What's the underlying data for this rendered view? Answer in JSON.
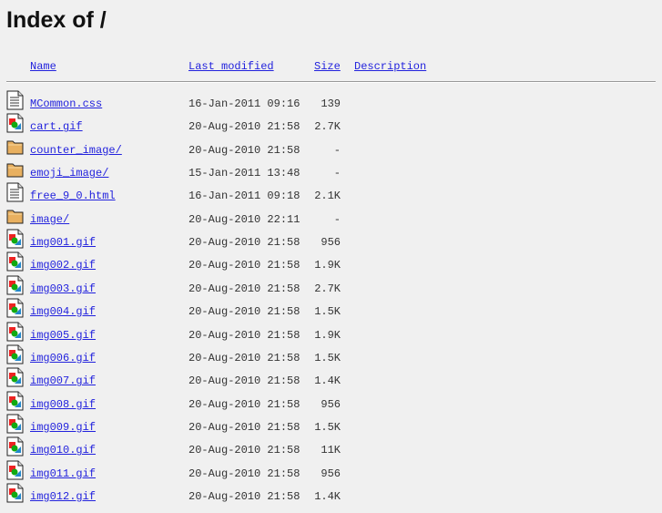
{
  "title": "Index of /",
  "columns": {
    "name": "Name",
    "modified": "Last modified",
    "size": "Size",
    "description": "Description"
  },
  "entries": [
    {
      "icon": "text",
      "name": "MCommon.css",
      "modified": "16-Jan-2011 09:16",
      "size": "139"
    },
    {
      "icon": "image",
      "name": "cart.gif",
      "modified": "20-Aug-2010 21:58",
      "size": "2.7K"
    },
    {
      "icon": "folder",
      "name": "counter_image/",
      "modified": "20-Aug-2010 21:58",
      "size": "-"
    },
    {
      "icon": "folder",
      "name": "emoji_image/",
      "modified": "15-Jan-2011 13:48",
      "size": "-"
    },
    {
      "icon": "text",
      "name": "free_9_0.html",
      "modified": "16-Jan-2011 09:18",
      "size": "2.1K"
    },
    {
      "icon": "folder",
      "name": "image/",
      "modified": "20-Aug-2010 22:11",
      "size": "-"
    },
    {
      "icon": "image",
      "name": "img001.gif",
      "modified": "20-Aug-2010 21:58",
      "size": "956"
    },
    {
      "icon": "image",
      "name": "img002.gif",
      "modified": "20-Aug-2010 21:58",
      "size": "1.9K"
    },
    {
      "icon": "image",
      "name": "img003.gif",
      "modified": "20-Aug-2010 21:58",
      "size": "2.7K"
    },
    {
      "icon": "image",
      "name": "img004.gif",
      "modified": "20-Aug-2010 21:58",
      "size": "1.5K"
    },
    {
      "icon": "image",
      "name": "img005.gif",
      "modified": "20-Aug-2010 21:58",
      "size": "1.9K"
    },
    {
      "icon": "image",
      "name": "img006.gif",
      "modified": "20-Aug-2010 21:58",
      "size": "1.5K"
    },
    {
      "icon": "image",
      "name": "img007.gif",
      "modified": "20-Aug-2010 21:58",
      "size": "1.4K"
    },
    {
      "icon": "image",
      "name": "img008.gif",
      "modified": "20-Aug-2010 21:58",
      "size": "956"
    },
    {
      "icon": "image",
      "name": "img009.gif",
      "modified": "20-Aug-2010 21:58",
      "size": "1.5K"
    },
    {
      "icon": "image",
      "name": "img010.gif",
      "modified": "20-Aug-2010 21:58",
      "size": "11K"
    },
    {
      "icon": "image",
      "name": "img011.gif",
      "modified": "20-Aug-2010 21:58",
      "size": "956"
    },
    {
      "icon": "image",
      "name": "img012.gif",
      "modified": "20-Aug-2010 21:58",
      "size": "1.4K"
    }
  ]
}
